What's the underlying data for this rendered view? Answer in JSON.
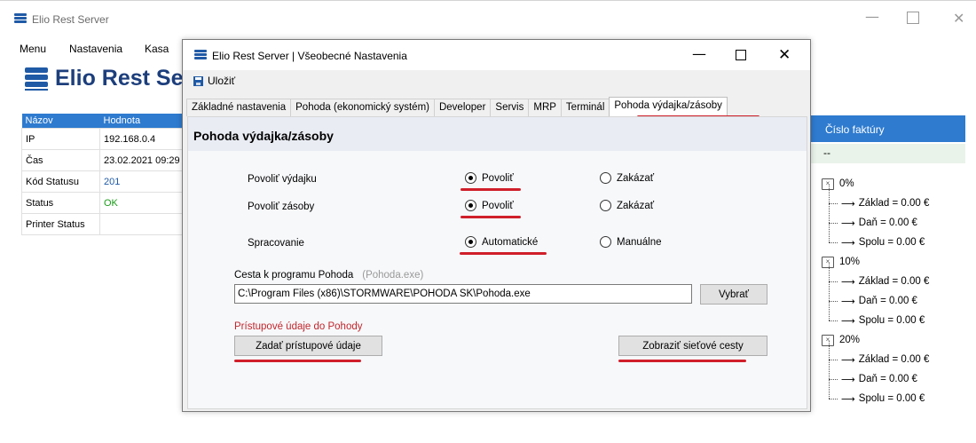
{
  "main_window": {
    "title": "Elio Rest Server",
    "minimize_glyph": "—",
    "close_glyph": "✕",
    "menu": [
      "Menu",
      "Nastavenia",
      "Kasa"
    ],
    "big_title": "Elio Rest Server"
  },
  "status_table": {
    "headers": [
      "Názov",
      "Hodnota"
    ],
    "rows": [
      {
        "name": "IP",
        "value": "192.168.0.4"
      },
      {
        "name": "Čas",
        "value": "23.02.2021 09:29"
      },
      {
        "name": "Kód Statusu",
        "value": "201"
      },
      {
        "name": "Status",
        "value": "OK"
      },
      {
        "name": "Printer Status",
        "value": ""
      }
    ]
  },
  "right_panel": {
    "header": "Číslo faktúry",
    "first_row": "--",
    "groups": [
      {
        "label": "0%",
        "items": [
          "Základ = 0.00 €",
          "Daň = 0.00 €",
          "Spolu = 0.00 €"
        ]
      },
      {
        "label": "10%",
        "items": [
          "Základ = 0.00 €",
          "Daň = 0.00 €",
          "Spolu = 0.00 €"
        ]
      },
      {
        "label": "20%",
        "items": [
          "Základ = 0.00 €",
          "Daň = 0.00 €",
          "Spolu = 0.00 €"
        ]
      }
    ]
  },
  "dialog": {
    "title": "Elio Rest Server | Všeobecné Nastavenia",
    "minimize_glyph": "—",
    "close_glyph": "✕",
    "save_label": "Uložiť",
    "tabs": [
      "Základné nastavenia",
      "Pohoda (ekonomický systém)",
      "Developer",
      "Servis",
      "MRP",
      "Terminál",
      "Pohoda výdajka/zásoby"
    ],
    "active_tab": "Pohoda výdajka/zásoby",
    "panel_title": "Pohoda výdajka/zásoby",
    "options": [
      {
        "label": "Povoliť výdajku",
        "choice_a": "Povoliť",
        "choice_b": "Zakázať",
        "selected": "a"
      },
      {
        "label": "Povoliť zásoby",
        "choice_a": "Povoliť",
        "choice_b": "Zakázať",
        "selected": "a"
      },
      {
        "label": "Spracovanie",
        "choice_a": "Automatické",
        "choice_b": "Manuálne",
        "selected": "a"
      }
    ],
    "path_label": "Cesta k programu Pohoda",
    "path_hint": "(Pohoda.exe)",
    "path_value": "C:\\Program Files (x86)\\STORMWARE\\POHODA SK\\Pohoda.exe",
    "browse_label": "Vybrať",
    "access_title": "Prístupové údaje do Pohody",
    "creds_button": "Zadať prístupové údaje",
    "network_button": "Zobraziť sieťové cesty"
  },
  "colors": {
    "header_blue": "#2e7bcf",
    "title_navy": "#1c3e7c",
    "ok_green": "#1a9b1a",
    "annotation_red": "#d01f2a",
    "access_red": "#c0262c"
  }
}
